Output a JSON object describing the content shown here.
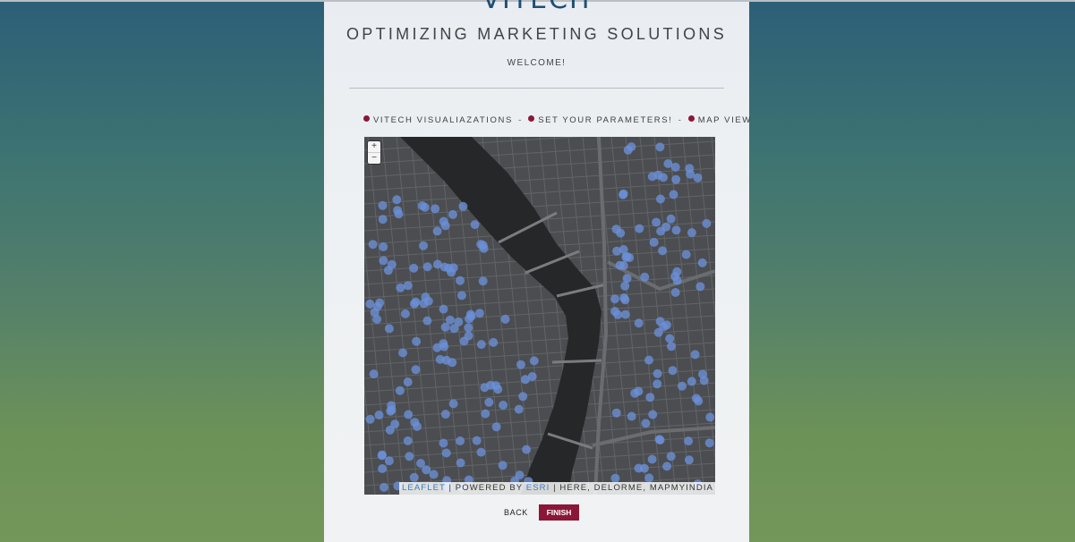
{
  "header": {
    "logo_text": "VITECH",
    "title": "OPTIMIZING MARKETING SOLUTIONS",
    "welcome": "WELCOME!"
  },
  "steps": [
    {
      "label": "VITECH VISUALIAZATIONS",
      "status": "done"
    },
    {
      "label": "SET YOUR PARAMETERS!",
      "status": "done"
    },
    {
      "label": "MAP VIEW",
      "status": "current"
    }
  ],
  "step_separator": "-",
  "map": {
    "zoom_in": "+",
    "zoom_out": "−",
    "attribution": {
      "leaflet": "LEAFLET",
      "sep1": " | POWERED BY ",
      "esri": "ESRI",
      "rest": " | HERE, DELORME, MAPMYINDIA"
    },
    "colors": {
      "land": "#4b4d50",
      "water": "#252729",
      "road": "#626568",
      "marker": "#6b8fd8"
    }
  },
  "footer": {
    "back_label": "BACK",
    "finish_label": "FINISH"
  },
  "colors": {
    "accent": "#8b1638",
    "title": "#3f4447",
    "link": "#3a7bbf"
  }
}
